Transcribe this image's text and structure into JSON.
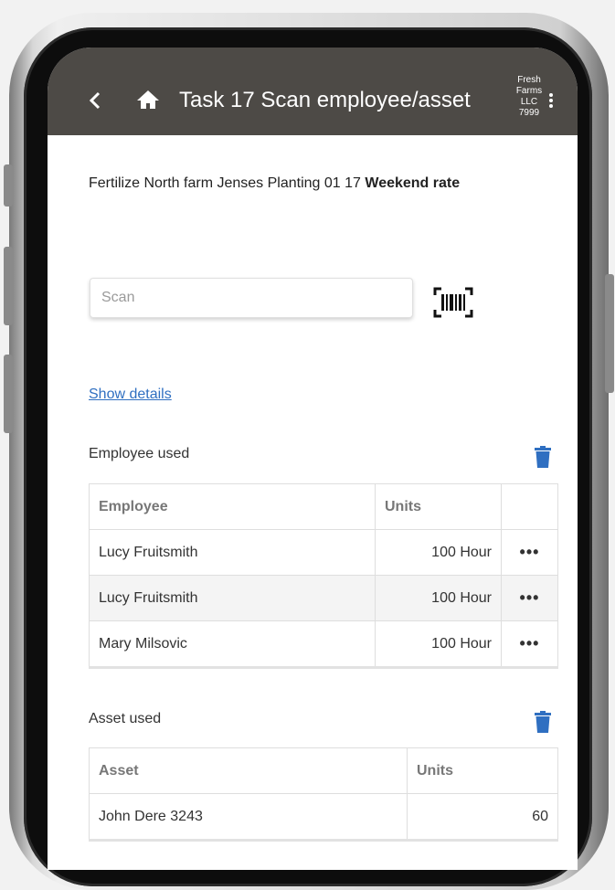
{
  "header": {
    "back_icon": "chevron-left-icon",
    "home_icon": "home-icon",
    "title": "Task 17 Scan employee/asset",
    "company_lines": [
      "Fresh",
      "Farms",
      "LLC",
      "7999"
    ],
    "menu_icon": "more-vertical-icon"
  },
  "task": {
    "description": "Fertilize North farm Jenses Planting 01 17",
    "rate": "Weekend rate"
  },
  "scan": {
    "placeholder": "Scan",
    "value": "",
    "barcode_icon": "barcode-scan-icon"
  },
  "details_link": "Show details",
  "employees": {
    "label": "Employee used",
    "delete_icon": "trash-icon",
    "columns": [
      "Employee",
      "Units",
      ""
    ],
    "rows": [
      {
        "name": "Lucy Fruitsmith",
        "units": "100 Hour",
        "action": "•••"
      },
      {
        "name": "Lucy Fruitsmith",
        "units": "100 Hour",
        "action": "•••"
      },
      {
        "name": "Mary Milsovic",
        "units": "100 Hour",
        "action": "•••"
      }
    ]
  },
  "assets": {
    "label": "Asset used",
    "delete_icon": "trash-icon",
    "columns": [
      "Asset",
      "Units"
    ],
    "rows": [
      {
        "name": "John Dere 3243",
        "units": "60"
      }
    ]
  },
  "colors": {
    "appbar": "#4d4a46",
    "link": "#2f6fc1",
    "trash": "#2f6fc1"
  }
}
